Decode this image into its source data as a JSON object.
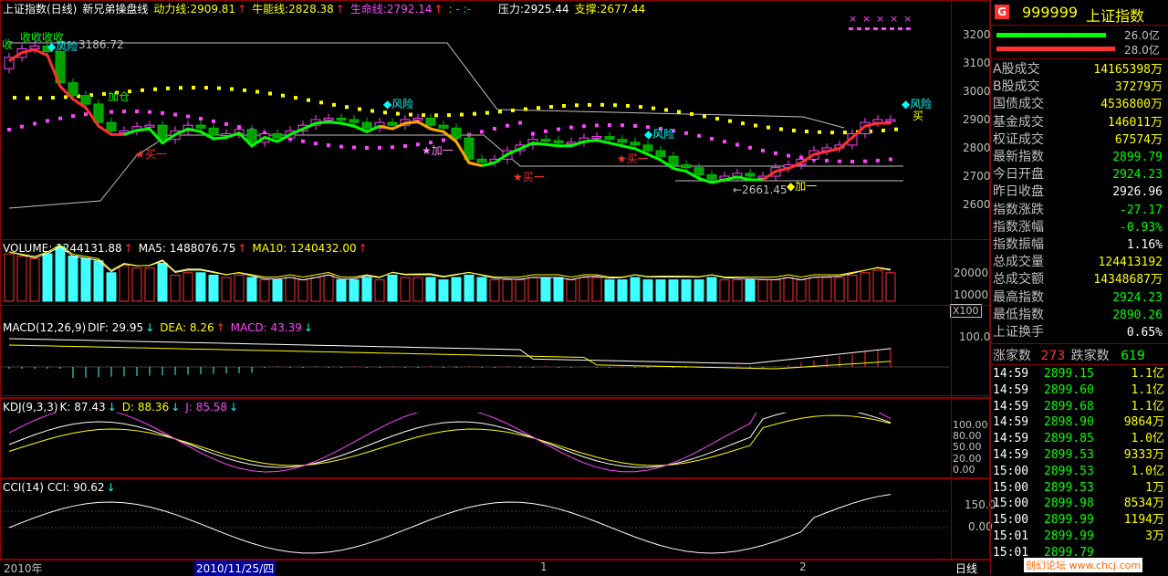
{
  "main_header": {
    "title": "上证指数(日线)",
    "formula": "新兄弟操盘线",
    "power_label": "动力线:",
    "power_value": "2909.81",
    "bull_label": "牛能线:",
    "bull_value": "2828.38",
    "life_label": "生命线:",
    "life_value": "2792.14",
    "extra": ": - :-",
    "pressure_label": "压力:",
    "pressure_value": "2925.44",
    "support_label": "支撑:",
    "support_value": "2677.44"
  },
  "price_axis": [
    "3200",
    "3100",
    "3000",
    "2900",
    "2800",
    "2700",
    "2600"
  ],
  "chart_labels": {
    "shou": "收",
    "shou_repeat": "收收收收",
    "fengxian1": "◆风险",
    "high_value": "3186.72",
    "jiacang": "加仓",
    "mai_left": "★买一",
    "jia_pink": "★加一",
    "fengxian2": "◆风险",
    "mai_mid": "★买一",
    "mai_right": "★买一",
    "fengxian3": "◆风险",
    "jia_yellow": "◆加一",
    "low_value": "←2661.45",
    "fengxian4": "◆风险",
    "mai_last": "买"
  },
  "volume_header": {
    "label": "VOLUME:",
    "value": "1244131.88",
    "ma5_label": "MA5:",
    "ma5_value": "1488076.75",
    "ma10_label": "MA10:",
    "ma10_value": "1240432.00"
  },
  "volume_axis": [
    "20000",
    "10000"
  ],
  "volume_unit": "X100",
  "macd_header": {
    "label": "MACD(12,26,9)",
    "dif_label": "DIF:",
    "dif_value": "29.95",
    "dea_label": "DEA:",
    "dea_value": "8.26",
    "macd_label": "MACD:",
    "macd_value": "43.39"
  },
  "macd_axis": [
    "100.0"
  ],
  "kdj_header": {
    "label": "KDJ(9,3,3)",
    "k_label": "K:",
    "k_value": "87.43",
    "d_label": "D:",
    "d_value": "88.36",
    "j_label": "J:",
    "j_value": "85.58"
  },
  "kdj_axis": [
    "100.00",
    "80.00",
    "50.00",
    "20.00",
    "0.00"
  ],
  "cci_header": {
    "label": "CCI(14)",
    "cci_label": "CCI:",
    "cci_value": "90.62"
  },
  "cci_axis": [
    "150.0",
    "0.00"
  ],
  "date_axis": {
    "year": "2010年",
    "cursor_date": "2010/11/25/四",
    "mark1": "1",
    "mark2": "2",
    "period": "日线"
  },
  "right_panel": {
    "logo": "G",
    "code": "999999",
    "name": "上证指数",
    "bar1_value": "26.0亿",
    "bar2_value": "28.0亿",
    "stats": [
      {
        "k": "A股成交",
        "v": "14165398万",
        "color": "yellow"
      },
      {
        "k": "B股成交",
        "v": "37279万",
        "color": "yellow"
      },
      {
        "k": "国债成交",
        "v": "4536800万",
        "color": "yellow"
      },
      {
        "k": "基金成交",
        "v": "146011万",
        "color": "yellow"
      },
      {
        "k": "权证成交",
        "v": "67574万",
        "color": "yellow"
      },
      {
        "k": "最新指数",
        "v": "2899.79",
        "color": "green"
      },
      {
        "k": "今日开盘",
        "v": "2924.23",
        "color": "green"
      },
      {
        "k": "昨日收盘",
        "v": "2926.96",
        "color": "white"
      },
      {
        "k": "指数涨跌",
        "v": "-27.17",
        "color": "green"
      },
      {
        "k": "指数涨幅",
        "v": "-0.93%",
        "color": "green"
      },
      {
        "k": "指数振幅",
        "v": "1.16%",
        "color": "white"
      },
      {
        "k": "总成交量",
        "v": "124413192",
        "color": "yellow"
      },
      {
        "k": "总成交额",
        "v": "14348687万",
        "color": "yellow"
      },
      {
        "k": "最高指数",
        "v": "2924.23",
        "color": "green"
      },
      {
        "k": "最低指数",
        "v": "2890.26",
        "color": "green"
      },
      {
        "k": "上证换手",
        "v": "0.65%",
        "color": "white"
      }
    ],
    "rise_label": "涨家数",
    "rise_value": "273",
    "fall_label": "跌家数",
    "fall_value": "619",
    "ticks": [
      {
        "t": "14:59",
        "p": "2899.15",
        "v": "1.1亿"
      },
      {
        "t": "14:59",
        "p": "2899.60",
        "v": "1.1亿"
      },
      {
        "t": "14:59",
        "p": "2899.68",
        "v": "1.1亿"
      },
      {
        "t": "14:59",
        "p": "2898.90",
        "v": "9864万"
      },
      {
        "t": "14:59",
        "p": "2899.85",
        "v": "1.0亿"
      },
      {
        "t": "14:59",
        "p": "2899.53",
        "v": "9333万"
      },
      {
        "t": "15:00",
        "p": "2899.53",
        "v": "1.0亿"
      },
      {
        "t": "15:00",
        "p": "2899.53",
        "v": "1万"
      },
      {
        "t": "15:00",
        "p": "2899.98",
        "v": "8534万"
      },
      {
        "t": "15:00",
        "p": "2899.99",
        "v": "1194万"
      },
      {
        "t": "15:01",
        "p": "2899.99",
        "v": "3万"
      },
      {
        "t": "15:01",
        "p": "2899.79",
        "v": ""
      }
    ],
    "watermark": "创幻论坛 www.chcj.com"
  },
  "colors": {
    "background": "#000000",
    "border": "#8b0000",
    "up": "#ff4fff",
    "down": "#00a000",
    "volume_up": "#40ffff",
    "accent_yellow": "#ffff00"
  }
}
